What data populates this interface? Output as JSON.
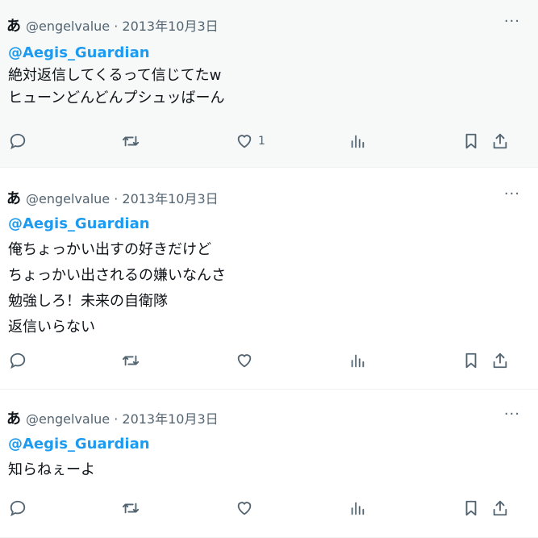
{
  "tweets": [
    {
      "name": "あ",
      "meta": "@engelvalue · 2013年10月3日",
      "more": "···",
      "mention": "@Aegis_Guardian",
      "lines": [
        "絶対返信してくるって信じてたw",
        "ヒューンどんどんプシュッばーん"
      ],
      "likes": "1"
    },
    {
      "name": "あ",
      "meta": "@engelvalue · 2013年10月3日",
      "more": "···",
      "mention": "@Aegis_Guardian",
      "lines": [
        "俺ちょっかい出すの好きだけど",
        "ちょっかい出されるの嫌いなんさ",
        "勉強しろ！未来の自衛隊",
        "返信いらない"
      ],
      "likes": ""
    },
    {
      "name": "あ",
      "meta": "@engelvalue · 2013年10月3日",
      "more": "···",
      "mention": "@Aegis_Guardian",
      "lines": [
        "知らねぇーよ"
      ],
      "likes": ""
    }
  ],
  "icons": [
    "reply-icon",
    "retweet-icon",
    "like-icon",
    "views-icon",
    "bookmark-icon",
    "share-icon"
  ],
  "colors": {
    "accent": "#1d9bf0",
    "muted": "#536471",
    "text": "#0f1419",
    "highlight_bg": "#f7f9f9"
  }
}
